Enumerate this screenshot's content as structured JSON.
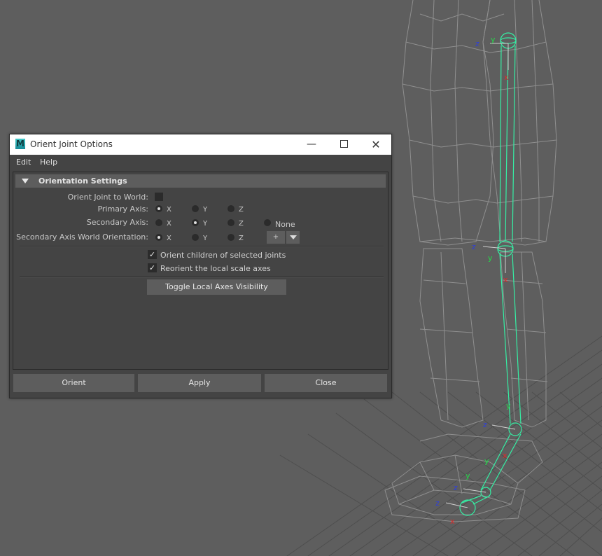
{
  "window": {
    "title": "Orient Joint Options",
    "logo_letter": "M"
  },
  "menu": [
    "Edit",
    "Help"
  ],
  "section": {
    "title": "Orientation Settings"
  },
  "fields": {
    "orient_to_world": {
      "label": "Orient Joint to World:",
      "checked": false
    },
    "primary_axis": {
      "label": "Primary Axis:",
      "options": [
        "X",
        "Y",
        "Z"
      ],
      "selected": "X"
    },
    "secondary_axis": {
      "label": "Secondary Axis:",
      "options": [
        "X",
        "Y",
        "Z",
        "None"
      ],
      "selected": "Y"
    },
    "secondary_world": {
      "label": "Secondary Axis World Orientation:",
      "options": [
        "X",
        "Y",
        "Z"
      ],
      "selected": "X",
      "sign": "+"
    }
  },
  "checks": [
    {
      "label": "Orient children of selected joints",
      "checked": true
    },
    {
      "label": "Reorient the local scale axes",
      "checked": true
    }
  ],
  "toggle_button": "Toggle Local Axes Visibility",
  "buttons": {
    "orient": "Orient",
    "apply": "Apply",
    "close": "Close"
  },
  "viewport": {
    "axis_labels": {
      "x": "x",
      "y": "y",
      "z": "z"
    },
    "colors": {
      "bone": "#35f0a5",
      "x_axis": "#e02a2a",
      "y_axis": "#25d84a",
      "z_axis": "#2f3fd8",
      "wire": "#8f8f8f",
      "grid": "#4c4c4c",
      "background": "#5e5e5e"
    }
  },
  "colors": {
    "dialog_bg": "#444444",
    "button_bg": "#5d5d5d",
    "titlebar_bg": "#ffffff"
  }
}
